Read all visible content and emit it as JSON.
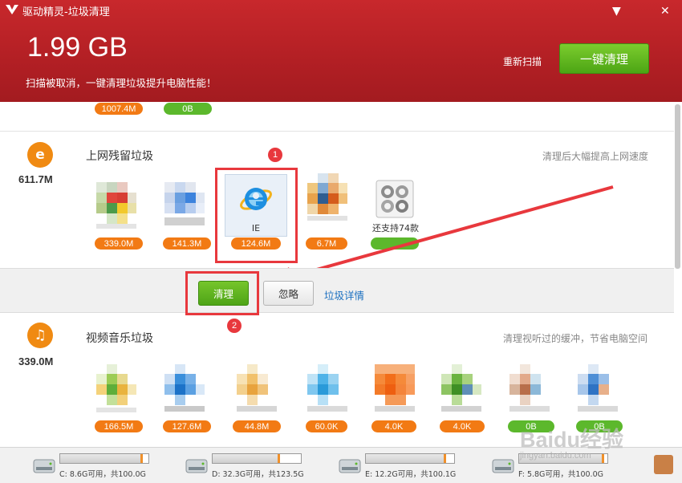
{
  "window": {
    "title": "驱动精灵-垃圾清理",
    "minimize_glyph": "▼",
    "close_glyph": "✕"
  },
  "header": {
    "total_size": "1.99 GB",
    "hint": "扫描被取消，一键清理垃圾提升电脑性能！",
    "rescan_label": "重新扫描",
    "clean_all_label": "一键清理"
  },
  "top_row": {
    "pills": [
      "1007.4M",
      "0B"
    ]
  },
  "web_section": {
    "icon": "ie-e-icon",
    "icon_glyph": "e",
    "size": "611.7M",
    "title": "上网残留垃圾",
    "tip": "清理后大幅提高上网速度",
    "items": [
      {
        "label": "",
        "size": "339.0M",
        "pill": "orange"
      },
      {
        "label": "",
        "size": "141.3M",
        "pill": "orange"
      },
      {
        "label": "IE",
        "size": "124.6M",
        "pill": "orange"
      },
      {
        "label": "",
        "size": "6.7M",
        "pill": "orange"
      },
      {
        "label": "还支持74款",
        "size": "",
        "pill": "green"
      }
    ],
    "clean_label": "清理",
    "ignore_label": "忽略",
    "detail_label": "垃圾详情"
  },
  "media_section": {
    "icon": "music-note-icon",
    "icon_glyph": "♫",
    "size": "339.0M",
    "title": "视频音乐垃圾",
    "tip": "清理视听过的缓冲，节省电脑空间",
    "items": [
      {
        "size": "166.5M",
        "pill": "orange"
      },
      {
        "size": "127.6M",
        "pill": "orange"
      },
      {
        "size": "44.8M",
        "pill": "orange"
      },
      {
        "size": "60.0K",
        "pill": "orange"
      },
      {
        "size": "4.0K",
        "pill": "orange"
      },
      {
        "size": "4.0K",
        "pill": "orange"
      },
      {
        "size": "0B",
        "pill": "green"
      },
      {
        "size": "0B",
        "pill": "green"
      }
    ]
  },
  "annotations": {
    "marker_1": "1",
    "marker_2": "2",
    "color": "#e8383d"
  },
  "disks": [
    {
      "label": "C: 8.6G可用，共100.0G",
      "used_fraction": 0.91
    },
    {
      "label": "D: 32.3G可用，共123.5G",
      "used_fraction": 0.74
    },
    {
      "label": "E: 12.2G可用，共100.1G",
      "used_fraction": 0.88
    },
    {
      "label": "F: 5.8G可用，共100.0G",
      "used_fraction": 0.94
    }
  ],
  "watermark": {
    "text": "Baidu经验",
    "url": "jingyan.baidu.com"
  },
  "colors": {
    "header_red": "#b21f24",
    "accent_green": "#4ca514",
    "pill_orange": "#f27a14",
    "pill_green": "#5cb82c",
    "link_blue": "#1a6fc0"
  }
}
